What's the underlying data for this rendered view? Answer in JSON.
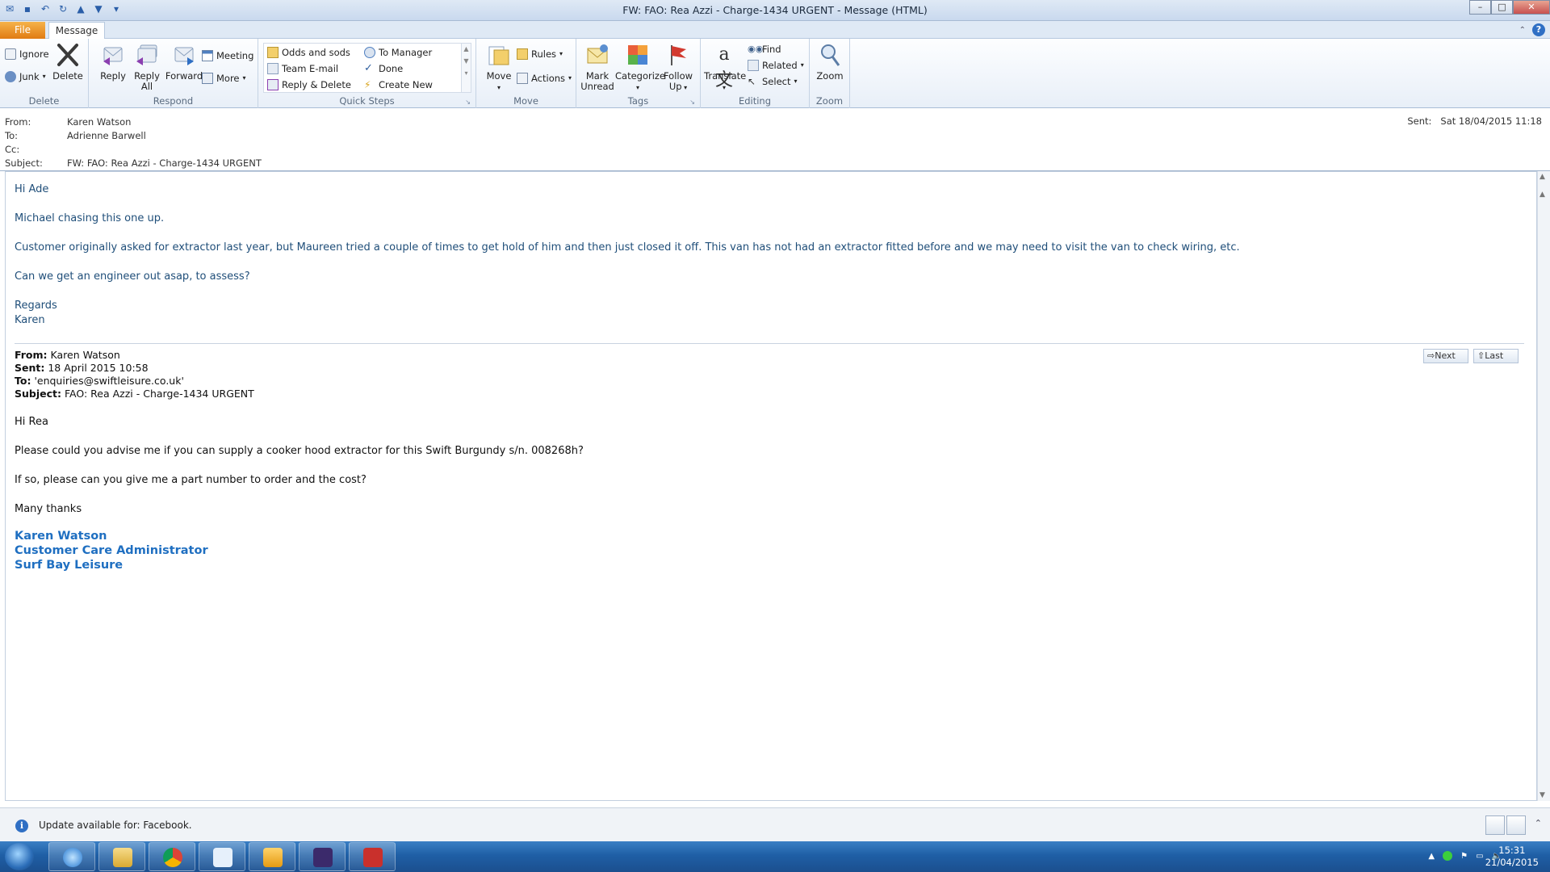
{
  "window": {
    "title": "FW: FAO: Rea Azzi - Charge-1434 URGENT  -  Message (HTML)"
  },
  "tabs": {
    "file": "File",
    "message": "Message"
  },
  "ribbon": {
    "delete_group": {
      "label": "Delete",
      "ignore": "Ignore",
      "junk": "Junk",
      "delete": "Delete"
    },
    "respond_group": {
      "label": "Respond",
      "reply": "Reply",
      "reply_all_1": "Reply",
      "reply_all_2": "All",
      "forward": "Forward",
      "meeting": "Meeting",
      "more": "More"
    },
    "quicksteps_group": {
      "label": "Quick Steps",
      "items": [
        "Odds and sods",
        "Team E-mail",
        "Reply & Delete",
        "To Manager",
        "Done",
        "Create New"
      ]
    },
    "move_group": {
      "label": "Move",
      "move": "Move",
      "rules": "Rules",
      "actions": "Actions"
    },
    "tags_group": {
      "label": "Tags",
      "mark_unread_1": "Mark",
      "mark_unread_2": "Unread",
      "categorize": "Categorize",
      "follow_up_1": "Follow",
      "follow_up_2": "Up"
    },
    "editing_group": {
      "label": "Editing",
      "translate": "Translate",
      "find": "Find",
      "related": "Related",
      "select": "Select"
    },
    "zoom_group": {
      "label": "Zoom",
      "zoom": "Zoom"
    }
  },
  "header": {
    "from_label": "From:",
    "from": "Karen Watson",
    "to_label": "To:",
    "to": "Adrienne Barwell",
    "cc_label": "Cc:",
    "cc": "",
    "subject_label": "Subject:",
    "subject": "FW: FAO: Rea Azzi - Charge-1434 URGENT",
    "sent_label": "Sent:",
    "sent": "Sat 18/04/2015 11:18"
  },
  "body": {
    "greeting": "Hi Ade",
    "line1": "Michael chasing this one up.",
    "line2": "Customer originally asked for extractor last year, but Maureen tried a couple of times to get hold of him and then just closed it off. This van has not had an extractor fitted before and we may need to visit the van to check wiring, etc.",
    "line3": "Can we get an engineer out asap, to assess?",
    "regards": "Regards",
    "name": "Karen"
  },
  "forwarded": {
    "from_label": "From:",
    "from": "Karen Watson",
    "sent_label": "Sent:",
    "sent": "18 April 2015 10:58",
    "to_label": "To:",
    "to": "'enquiries@swiftleisure.co.uk'",
    "subject_label": "Subject:",
    "subject": "FAO: Rea Azzi - Charge-1434 URGENT",
    "greeting": "Hi Rea",
    "line1": "Please could you advise me if you can supply a cooker hood extractor for this Swift Burgundy  s/n. 008268h?",
    "line2": "If so, please can you give me a part number to order and the cost?",
    "thanks": "Many thanks",
    "sig_name": "Karen Watson",
    "sig_title": "Customer Care Administrator",
    "sig_company": "Surf Bay Leisure",
    "next": "Next",
    "last": "Last"
  },
  "infobar": {
    "text": "Update available for: Facebook."
  },
  "taskbar": {
    "time": "15:31",
    "date": "21/04/2015"
  },
  "colors": {
    "accent_file_tab": "#e07b12",
    "body_text_blue": "#1f4e79",
    "signature_blue": "#1f6fc1",
    "taskbar": "#1f5fa6"
  }
}
